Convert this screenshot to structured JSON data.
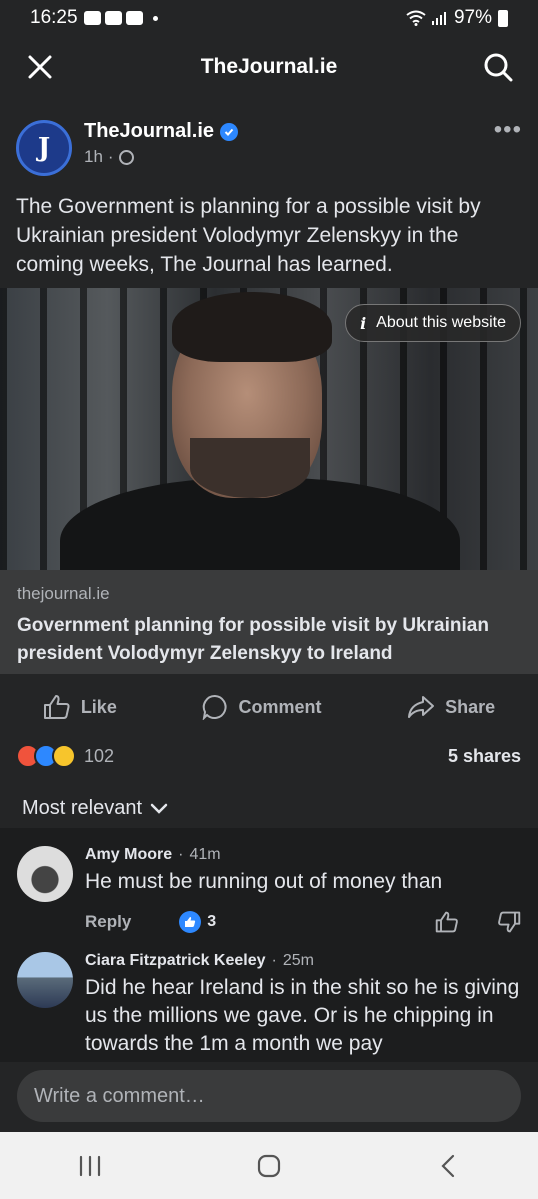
{
  "status_bar": {
    "time": "16:25",
    "battery": "97%"
  },
  "header": {
    "title": "TheJournal.ie"
  },
  "post": {
    "page_avatar_letter": "J",
    "page_name": "TheJournal.ie",
    "time": "1h",
    "text": "The Government is planning for a possible visit by Ukrainian president Volodymyr Zelenskyy in the coming weeks, The Journal has learned.",
    "about_website_label": "About this website",
    "link_domain": "thejournal.ie",
    "link_title": "Government planning for possible visit by Ukrainian president Volodymyr Zelenskyy to Ireland"
  },
  "actions": {
    "like": "Like",
    "comment": "Comment",
    "share": "Share"
  },
  "stats": {
    "reactions": "102",
    "shares": "5 shares"
  },
  "sort": {
    "label": "Most relevant"
  },
  "comments": [
    {
      "name": "Amy Moore",
      "time": "41m",
      "text": "He must be running out of money than",
      "reply": "Reply",
      "likes": "3"
    },
    {
      "name": "Ciara Fitzpatrick Keeley",
      "time": "25m",
      "text": "Did he hear Ireland is in the shit so he is giving us the millions we gave. Or is he chipping in towards the 1m a month we pay"
    }
  ],
  "composer": {
    "placeholder": "Write a comment…"
  },
  "colors": {
    "background": "#242526",
    "accent": "#2d88ff",
    "text": "#e4e6eb",
    "muted": "#b0b3b8"
  }
}
